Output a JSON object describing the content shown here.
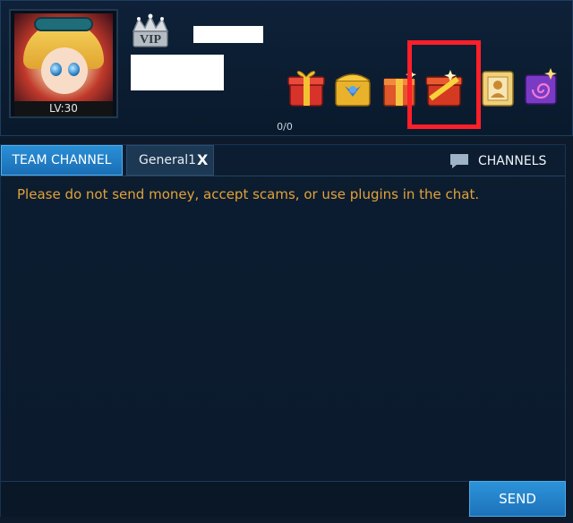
{
  "player": {
    "level_label": "LV:30",
    "vip_text": "VIP"
  },
  "rewards": {
    "progress": "0/0",
    "items": [
      {
        "icon": "gift-box-icon"
      },
      {
        "icon": "treasure-chest-icon"
      },
      {
        "icon": "gift-box-icon"
      },
      {
        "icon": "gift-box-icon",
        "highlighted": true
      },
      {
        "icon": "portrait-card-icon"
      },
      {
        "icon": "scroll-icon"
      }
    ]
  },
  "colors": {
    "highlight": "#ff1f2a",
    "accent_blue": "#1a6fb6",
    "notice_text": "#e3a236"
  },
  "chat": {
    "tabs": [
      {
        "label": "TEAM CHANNEL",
        "active": true
      },
      {
        "label": "General1",
        "active": false,
        "closable": true
      }
    ],
    "close_glyph": "X",
    "channels_label": "CHANNELS",
    "notice": "Please do not send money, accept scams, or use plugins in the chat.",
    "send_label": "SEND"
  }
}
